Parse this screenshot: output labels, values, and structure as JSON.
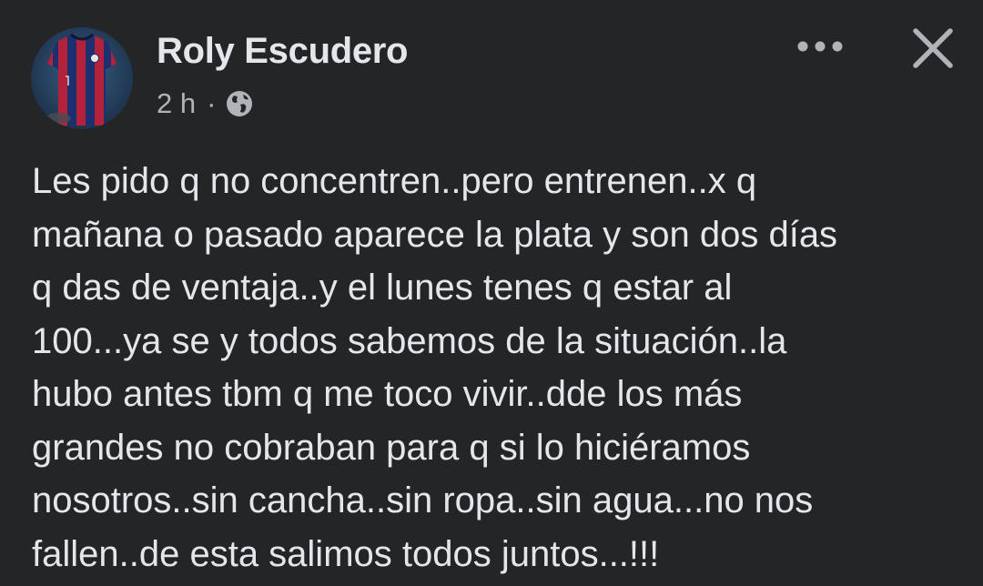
{
  "post": {
    "author": {
      "name": "Roly Escudero",
      "avatar_icon": "jersey-avatar"
    },
    "meta": {
      "time": "2 h",
      "separator": "·",
      "audience_icon": "globe-icon"
    },
    "actions": {
      "more_icon": "more-options-icon",
      "close_icon": "close-icon"
    },
    "text_lines": [
      "Les pido q no concentren..pero entrenen..x q",
      "mañana o pasado aparece la plata y son dos días",
      "q das de ventaja..y el lunes tenes q estar al",
      "100...ya se y todos sabemos de la situación..la",
      "hubo antes tbm q me toco vivir..dde los más",
      "grandes no cobraban para q si lo hiciéramos",
      "nosotros..sin cancha..sin ropa..sin agua...no nos",
      "fallen..de esta salimos todos juntos...!!!"
    ]
  },
  "colors": {
    "background": "#242526",
    "primary_text": "#e4e6eb",
    "secondary_text": "#b0b3b8",
    "jersey_red": "#b3223a",
    "jersey_blue": "#1c2f6e"
  }
}
